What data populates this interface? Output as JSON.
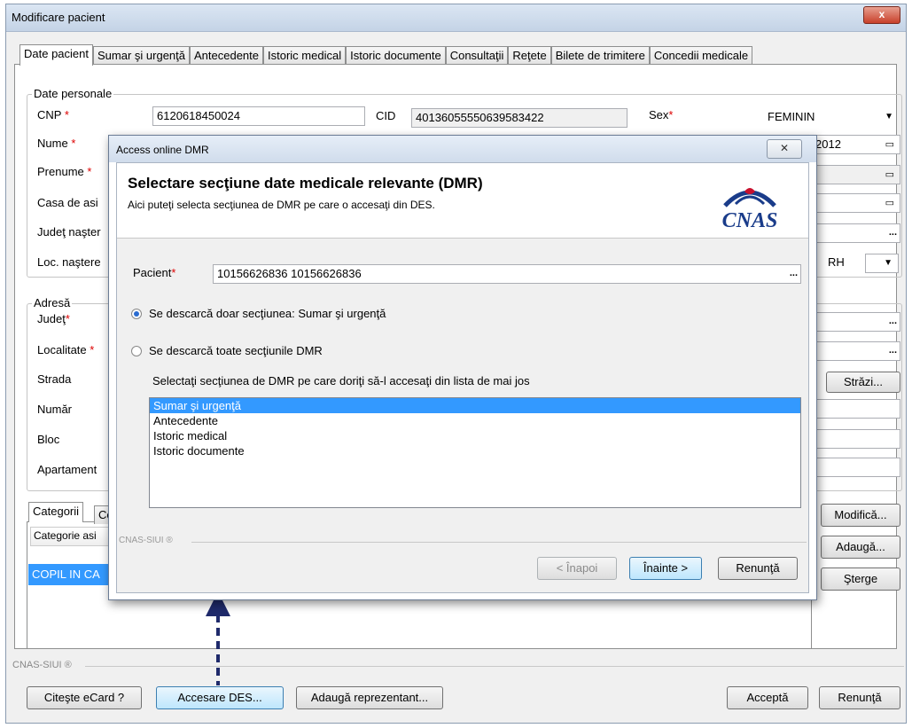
{
  "window": {
    "title": "Modificare pacient",
    "close_glyph": "x"
  },
  "tabs": [
    "Date pacient",
    "Sumar şi urgenţă",
    "Antecedente",
    "Istoric medical",
    "Istoric documente",
    "Consultaţii",
    "Reţete",
    "Bilete de trimitere",
    "Concedii medicale"
  ],
  "personal": {
    "legend": "Date personale",
    "cnp_label": "CNP",
    "cnp_value": "6120618450024",
    "cid_label": "CID",
    "cid_value": "40136055550639583422",
    "sex_label": "Sex",
    "sex_value": "FEMININ",
    "nume_label": "Nume",
    "prenume_label": "Prenume",
    "casa_label": "Casa de asi",
    "judet_nastere_label": "Judeţ naşter",
    "loc_nastere_label": "Loc. naştere",
    "date_partial": "2012",
    "rh_label": "RH"
  },
  "address": {
    "legend": "Adresă",
    "judet_label": "Judeţ",
    "localitate_label": "Localitate",
    "strada_label": "Strada",
    "numar_label": "Număr",
    "bloc_label": "Bloc",
    "apartament_label": "Apartament",
    "strazi_button": "Străzi..."
  },
  "categories": {
    "tab_label": "Categorii",
    "tab2_partial": "Ce",
    "column_header": "Categorie asi",
    "row_value": "COPIL IN CA",
    "modify_button": "Modifică...",
    "add_button": "Adaugă...",
    "delete_button": "Şterge"
  },
  "footer": {
    "caption": "CNAS-SIUI ®",
    "read_card": "Citeşte eCard ?",
    "des_access": "Accesare DES...",
    "add_rep": "Adaugă reprezentant...",
    "accept": "Acceptă",
    "cancel": "Renunţă"
  },
  "dialog": {
    "title": "Access online DMR",
    "close_glyph": "✕",
    "heading": "Selectare secţiune date medicale relevante (DMR)",
    "subheading": "Aici puteţi selecta secţiunea de DMR pe care o accesaţi din DES.",
    "logo_text": "CNAS",
    "pacient_label": "Pacient",
    "pacient_value": "10156626836 10156626836",
    "radio1_label": "Se descarcă doar secţiunea: Sumar şi urgenţă",
    "radio1_checked": true,
    "radio2_label": "Se descarcă toate secţiunile DMR",
    "list_prompt": "Selectaţi secţiunea de DMR pe care doriţi să-l accesaţi din lista de mai jos",
    "list_items": [
      "Sumar şi urgenţă",
      "Antecedente",
      "Istoric medical",
      "Istoric documente"
    ],
    "selected_index": 0,
    "caption": "CNAS-SIUI ®",
    "back_button": "< Înapoi",
    "next_button": "Înainte >",
    "cancel_button": "Renunţă"
  },
  "colors": {
    "selection": "#3399ff",
    "accent_arrow": "#1f2a6b",
    "required": "#dd0000"
  }
}
